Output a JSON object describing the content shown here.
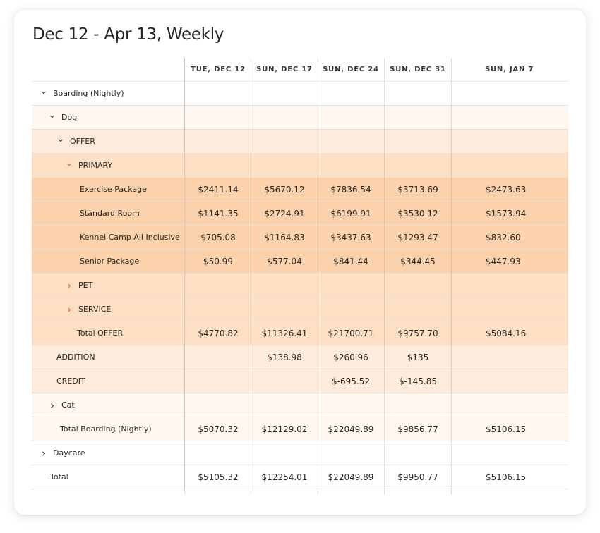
{
  "title": "Dec 12 - Apr 13, Weekly",
  "columns": [
    "TUE, DEC 12",
    "SUN, DEC 17",
    "SUN, DEC 24",
    "SUN, DEC 31",
    "SUN, JAN 7"
  ],
  "rows": [
    {
      "label": "Boarding (Nightly)",
      "indent": 10,
      "chevron": "down",
      "chevron_color": "dark",
      "bg": "bg0",
      "values": [
        "",
        "",
        "",
        "",
        ""
      ]
    },
    {
      "label": "Dog",
      "indent": 22,
      "chevron": "down",
      "chevron_color": "dark",
      "bg": "bg1",
      "values": [
        "",
        "",
        "",
        "",
        ""
      ]
    },
    {
      "label": "OFFER",
      "indent": 34,
      "chevron": "down",
      "chevron_color": "dark",
      "bg": "bg2",
      "values": [
        "",
        "",
        "",
        "",
        ""
      ]
    },
    {
      "label": "PRIMARY",
      "indent": 46,
      "chevron": "down",
      "chevron_color": "orange",
      "bg": "bg3",
      "values": [
        "",
        "",
        "",
        "",
        ""
      ]
    },
    {
      "label": "Exercise Package",
      "indent": 68,
      "chevron": "",
      "bg": "bg4",
      "values": [
        "$2411.14",
        "$5670.12",
        "$7836.54",
        "$3713.69",
        "$2473.63"
      ]
    },
    {
      "label": "Standard Room",
      "indent": 68,
      "chevron": "",
      "bg": "bg4",
      "values": [
        "$1141.35",
        "$2724.91",
        "$6199.91",
        "$3530.12",
        "$1573.94"
      ]
    },
    {
      "label": "Kennel Camp All Inclusive",
      "indent": 68,
      "chevron": "",
      "bg": "bg4",
      "values": [
        "$705.08",
        "$1164.83",
        "$3437.63",
        "$1293.47",
        "$832.60"
      ]
    },
    {
      "label": "Senior Package",
      "indent": 68,
      "chevron": "",
      "bg": "bg4",
      "values": [
        "$50.99",
        "$577.04",
        "$841.44",
        "$344.45",
        "$447.93"
      ]
    },
    {
      "label": "PET",
      "indent": 46,
      "chevron": "right",
      "chevron_color": "orange",
      "bg": "bg3",
      "values": [
        "",
        "",
        "",
        "",
        ""
      ]
    },
    {
      "label": "SERVICE",
      "indent": 46,
      "chevron": "right",
      "chevron_color": "orange",
      "bg": "bg3",
      "values": [
        "",
        "",
        "",
        "",
        ""
      ]
    },
    {
      "label": "Total OFFER",
      "indent": 64,
      "chevron": "",
      "bg": "bg3",
      "values": [
        "$4770.82",
        "$11326.41",
        "$21700.71",
        "$9757.70",
        "$5084.16"
      ]
    },
    {
      "label": "ADDITION",
      "indent": 35,
      "chevron": "",
      "bg": "bg2",
      "values": [
        "",
        "$138.98",
        "$260.96",
        "$135",
        ""
      ]
    },
    {
      "label": "CREDIT",
      "indent": 35,
      "chevron": "",
      "bg": "bg2",
      "values": [
        "",
        "",
        "$-695.52",
        "$-145.85",
        ""
      ]
    },
    {
      "label": "Cat",
      "indent": 22,
      "chevron": "right",
      "chevron_color": "dark",
      "bg": "bg1",
      "values": [
        "",
        "",
        "",
        "",
        ""
      ]
    },
    {
      "label": "Total Boarding (Nightly)",
      "indent": 40,
      "chevron": "",
      "bg": "bg1",
      "values": [
        "$5070.32",
        "$12129.02",
        "$22049.89",
        "$9856.77",
        "$5106.15"
      ]
    },
    {
      "label": "Daycare",
      "indent": 10,
      "chevron": "right",
      "chevron_color": "dark",
      "bg": "bg0",
      "values": [
        "",
        "",
        "",
        "",
        ""
      ]
    },
    {
      "label": "Total",
      "indent": 26,
      "chevron": "",
      "bg": "bg0",
      "values": [
        "$5105.32",
        "$12254.01",
        "$22049.89",
        "$9950.77",
        "$5106.15"
      ]
    }
  ]
}
